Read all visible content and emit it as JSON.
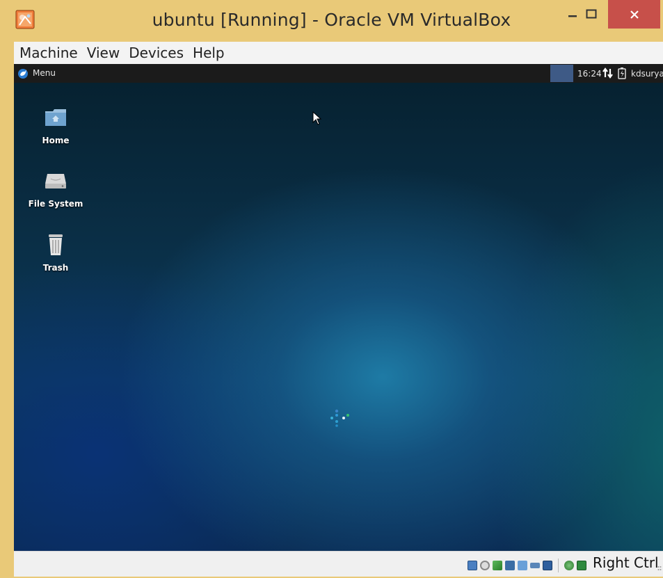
{
  "window": {
    "title": "ubuntu [Running] - Oracle VM VirtualBox",
    "accent_close": "#c7504a",
    "frame_color": "#e9c978"
  },
  "menubar": {
    "items": [
      "Machine",
      "View",
      "Devices",
      "Help"
    ]
  },
  "panel": {
    "menu_label": "Menu",
    "clock": "16:24",
    "user": "kdsurya"
  },
  "desktop": {
    "icons": [
      {
        "label": "Home",
        "icon": "home-folder-icon"
      },
      {
        "label": "File System",
        "icon": "drive-icon"
      },
      {
        "label": "Trash",
        "icon": "trash-icon"
      }
    ]
  },
  "statusbar": {
    "host_key": "Right Ctrl",
    "icons": [
      "hard-disk-icon",
      "optical-drive-icon",
      "audio-icon",
      "network-icon",
      "shared-folders-icon",
      "display-icon",
      "usb-icon",
      "recording-icon",
      "mouse-integration-icon"
    ]
  }
}
